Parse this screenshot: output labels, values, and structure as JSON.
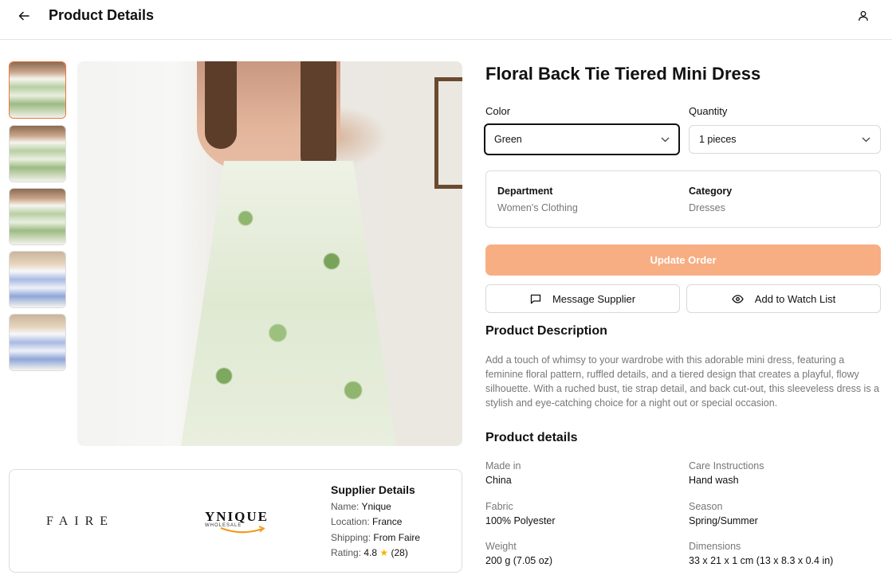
{
  "header": {
    "title": "Product Details",
    "back_icon": "arrow-left-icon",
    "user_icon": "user-icon"
  },
  "gallery": {
    "thumbnails": [
      {
        "label": "green dress front",
        "active": true
      },
      {
        "label": "green dress back"
      },
      {
        "label": "green dress side"
      },
      {
        "label": "blue dress front"
      },
      {
        "label": "blue dress back"
      }
    ]
  },
  "supplier": {
    "logos": {
      "faire": "FAIRE",
      "ynique": "YNIQUE",
      "ynique_sub": "WHOLESALE"
    },
    "title": "Supplier Details",
    "name_label": "Name:",
    "name": "Ynique",
    "location_label": "Location:",
    "location": "France",
    "shipping_label": "Shipping:",
    "shipping": "From Faire",
    "rating_label": "Rating:",
    "rating": "4.8",
    "rating_star": "★",
    "rating_count": "(28)"
  },
  "product": {
    "title": "Floral Back Tie Tiered Mini Dress",
    "color_label": "Color",
    "color_value": "Green",
    "quantity_label": "Quantity",
    "quantity_value": "1 pieces",
    "department_label": "Department",
    "department_value": "Women's Clothing",
    "category_label": "Category",
    "category_value": "Dresses"
  },
  "actions": {
    "update_order": "Update Order",
    "message_supplier": "Message Supplier",
    "watch_list": "Add to Watch List"
  },
  "description": {
    "title": "Product Description",
    "text": "Add a touch of whimsy to your wardrobe with this adorable mini dress, featuring a feminine floral pattern, ruffled details, and a tiered design that creates a playful, flowy silhouette. With a ruched bust, tie strap detail, and back cut-out, this sleeveless dress is a stylish and eye-catching choice for a night out or special occasion."
  },
  "details": {
    "title": "Product details",
    "made_in_label": "Made in",
    "made_in": "China",
    "care_label": "Care Instructions",
    "care": "Hand wash",
    "fabric_label": "Fabric",
    "fabric": "100% Polyester",
    "season_label": "Season",
    "season": "Spring/Summer",
    "weight_label": "Weight",
    "weight": "200 g (7.05 oz)",
    "dimensions_label": "Dimensions",
    "dimensions": "33 x 21 x 1 cm (13 x 8.3 x 0.4 in)"
  },
  "colors": {
    "accent": "#f7ae82",
    "active_thumb_border": "#e9773a",
    "star": "#f5b400"
  }
}
